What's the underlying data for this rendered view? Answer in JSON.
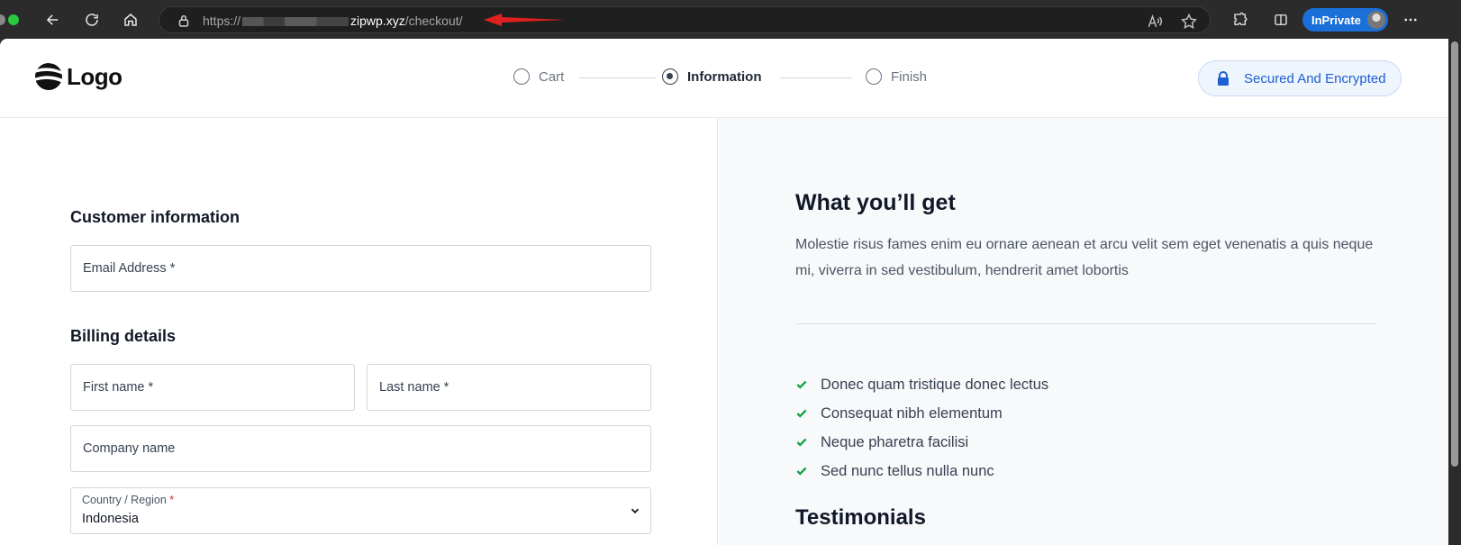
{
  "browser": {
    "url_prefix": "https://",
    "url_domain": "zipwp.xyz",
    "url_path": "/checkout/",
    "inprivate_label": "InPrivate"
  },
  "header": {
    "logo_text": "Logo",
    "steps": [
      {
        "label": "Cart",
        "state": "inactive"
      },
      {
        "label": "Information",
        "state": "active"
      },
      {
        "label": "Finish",
        "state": "inactive"
      }
    ],
    "secure_label": "Secured And Encrypted"
  },
  "form": {
    "customer_title": "Customer information",
    "email_label": "Email Address *",
    "billing_title": "Billing details",
    "first_name_label": "First name *",
    "last_name_label": "Last name *",
    "company_label": "Company name",
    "country_label": "Country / Region",
    "country_required": "*",
    "country_value": "Indonesia"
  },
  "summary": {
    "title": "What you’ll get",
    "description": "Molestie risus fames enim eu ornare aenean et arcu velit sem eget venenatis a quis neque mi, viverra in sed vestibulum, hendrerit amet lobortis",
    "benefits": [
      "Donec quam tristique donec lectus",
      "Consequat nibh elementum",
      "Neque pharetra facilisi",
      "Sed nunc tellus nulla nunc"
    ],
    "testimonials_title": "Testimonials"
  },
  "colors": {
    "accent_blue": "#1c5fd1",
    "check_green": "#16a34a",
    "required_red": "#dc2626",
    "annotation_arrow": "#e0201f"
  }
}
